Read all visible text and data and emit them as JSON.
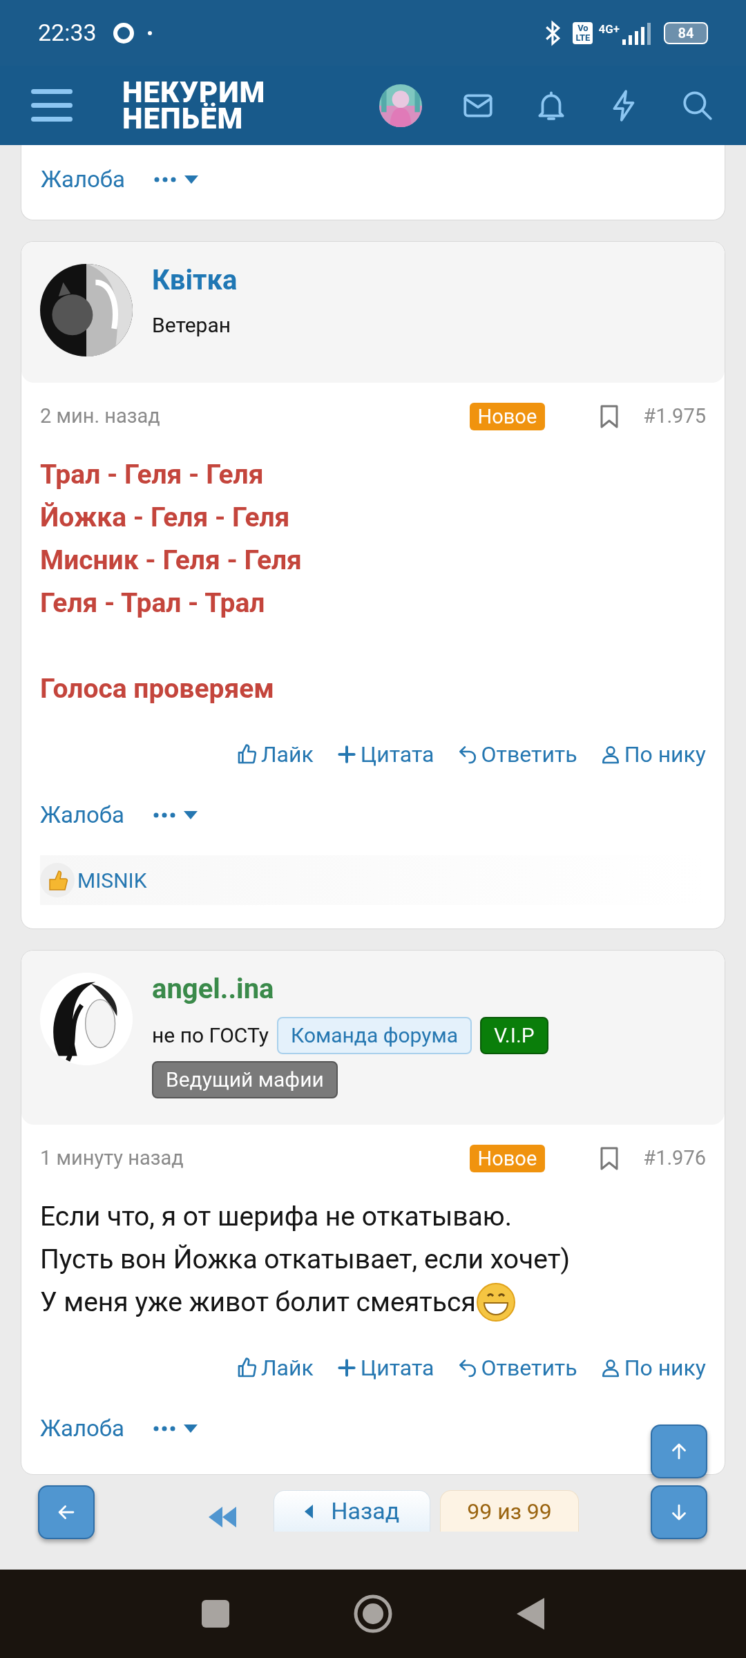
{
  "status_bar": {
    "time": "22:33",
    "volte": [
      "Vo",
      "LTE"
    ],
    "network": "4G+",
    "battery": "84"
  },
  "header": {
    "logo_lines": [
      "НЕКУРИМ",
      "НЕПЬЁМ"
    ]
  },
  "posts": [
    {
      "kind": "partial",
      "report": "Жалоба"
    },
    {
      "kind": "full",
      "author": {
        "name": "Квітка",
        "color": "#1f77b4",
        "rank": "Ветеран"
      },
      "time": "2 мин. назад",
      "label": "Новое",
      "number": "#1.975",
      "body": [
        {
          "lines": [
            {
              "kind": "emphasis",
              "text": "Трал - Геля - Геля"
            },
            {
              "kind": "emphasis",
              "text": "Йожка - Геля - Геля"
            },
            {
              "kind": "emphasis",
              "text": "Мисник - Геля - Геля"
            },
            {
              "kind": "emphasis",
              "text": "Геля - Трал - Трал"
            }
          ]
        },
        {
          "lines": [
            {
              "kind": "emphasis",
              "text": "Голоса проверяем"
            }
          ]
        }
      ],
      "actions": [
        {
          "kind": "like",
          "label": "Лайк"
        },
        {
          "kind": "quote",
          "label": "Цитата"
        },
        {
          "kind": "reply",
          "label": "Ответить"
        },
        {
          "kind": "user",
          "label": "По нику"
        }
      ],
      "report": "Жалоба",
      "reactions": [
        "MISNIK"
      ]
    },
    {
      "kind": "full",
      "author": {
        "name": "angel..ina",
        "color": "#3a8a4a",
        "rank": "не по ГОСТу",
        "badges": [
          {
            "kind": "team",
            "label": "Команда форума"
          },
          {
            "kind": "vip",
            "label": "V.I.P"
          },
          {
            "kind": "host",
            "label": "Ведущий мафии"
          }
        ]
      },
      "time": "1 минуту назад",
      "label": "Новое",
      "number": "#1.976",
      "body": [
        {
          "lines": [
            {
              "kind": "plain",
              "text": "Если что, я от шерифа не откатываю."
            },
            {
              "kind": "plain",
              "text": "Пусть вон Йожка откатывает, если хочет)"
            },
            {
              "kind": "plain_emoji",
              "text": "У меня уже живот болит смеяться"
            }
          ]
        }
      ],
      "actions": [
        {
          "kind": "like",
          "label": "Лайк"
        },
        {
          "kind": "quote",
          "label": "Цитата"
        },
        {
          "kind": "reply",
          "label": "Ответить"
        },
        {
          "kind": "user",
          "label": "По нику"
        }
      ],
      "report": "Жалоба"
    }
  ],
  "pagination": {
    "back": "Назад",
    "page": "99 из 99"
  }
}
